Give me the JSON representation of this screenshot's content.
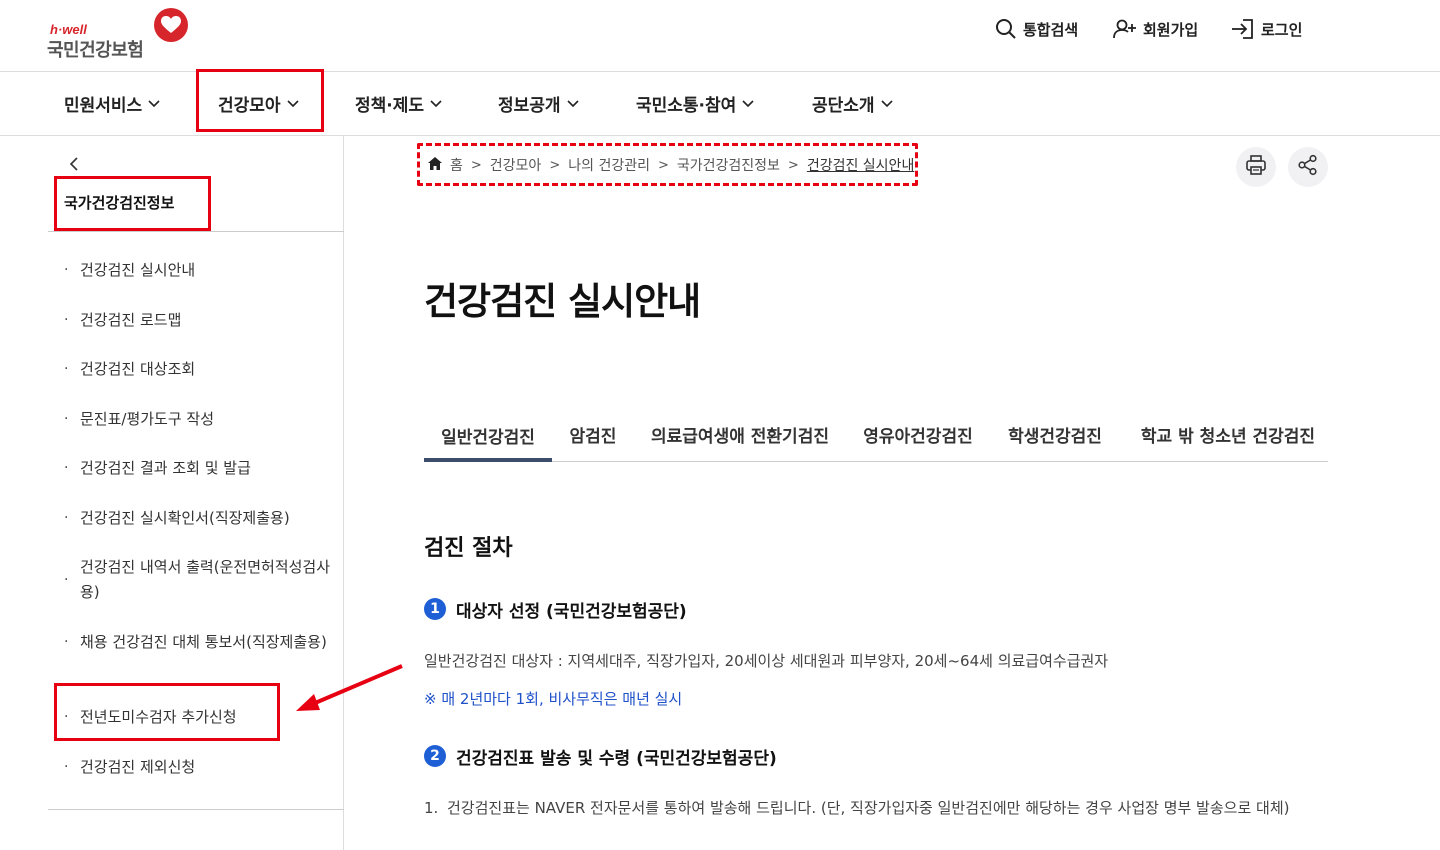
{
  "header": {
    "logo_small": "h·well",
    "logo_main": "국민건강보험",
    "search_label": "통합검색",
    "signup_label": "회원가입",
    "login_label": "로그인"
  },
  "gnb": {
    "items": [
      "민원서비스",
      "건강모아",
      "정책·제도",
      "정보공개",
      "국민소통·참여",
      "공단소개"
    ]
  },
  "sidebar": {
    "title": "국가건강검진정보",
    "items": [
      "건강검진 실시안내",
      "건강검진 로드맵",
      "건강검진 대상조회",
      "문진표/평가도구 작성",
      "건강검진 결과 조회 및 발급",
      "건강검진 실시확인서(직장제출용)",
      "건강검진 내역서 출력(운전면허적성검사용)",
      "채용 건강검진 대체 통보서(직장제출용)",
      "전년도미수검자 추가신청",
      "건강검진 제외신청"
    ]
  },
  "breadcrumb": {
    "items": [
      "홈",
      "건강모아",
      "나의 건강관리",
      "국가건강검진정보",
      "건강검진 실시안내"
    ]
  },
  "main": {
    "title": "건강검진 실시안내",
    "tabs": [
      "일반건강검진",
      "암검진",
      "의료급여생애 전환기검진",
      "영유아건강검진",
      "학생건강검진",
      "학교 밖 청소년 건강검진"
    ],
    "section_title": "검진 절차",
    "steps": [
      {
        "num": "1",
        "title": "대상자 선정 (국민건강보험공단)"
      },
      {
        "num": "2",
        "title": "건강검진표 발송 및 수령 (국민건강보험공단)"
      }
    ],
    "step1_desc": "일반건강검진 대상자 : 지역세대주, 직장가입자, 20세이상 세대원과 피부양자, 20세~64세 의료급여수급권자",
    "step1_note": "※ 매 2년마다 1회, 비사무직은 매년 실시",
    "step2_list": [
      {
        "num": "1.",
        "text": "건강검진표는 NAVER 전자문서를 통하여 발송해 드립니다. (단, 직장가입자중 일반검진에만 해당하는 경우 사업장 명부 발송으로 대체)"
      }
    ]
  },
  "colors": {
    "accent_red": "#e60012",
    "brand_red": "#d7262b",
    "step_blue": "#1f5fd6",
    "note_blue": "#1f52c9",
    "tab_active": "#3c4d6b"
  }
}
